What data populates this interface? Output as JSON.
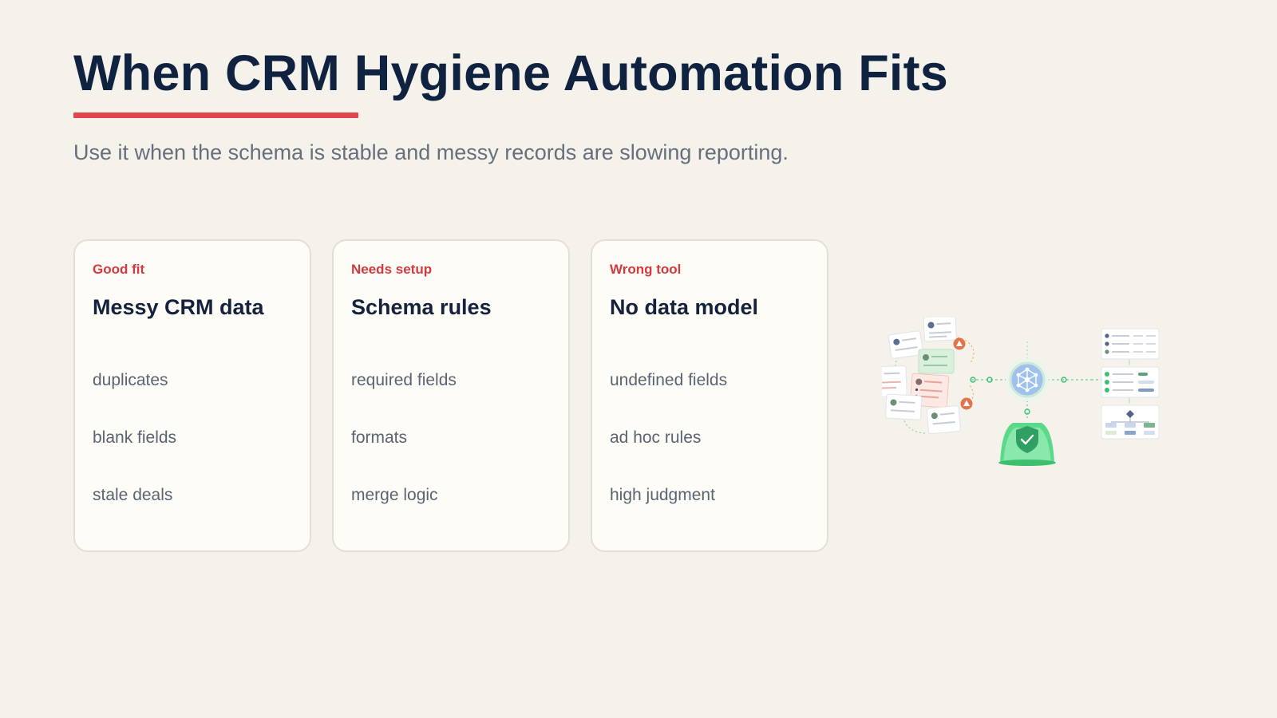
{
  "title": "When CRM Hygiene Automation Fits",
  "subtitle": "Use it when the schema is stable and messy records are slowing reporting.",
  "accent_color": "#e0464d",
  "cards": [
    {
      "tag": "Good fit",
      "title": "Messy CRM data",
      "items": [
        "duplicates",
        "blank fields",
        "stale deals"
      ]
    },
    {
      "tag": "Needs setup",
      "title": "Schema rules",
      "items": [
        "required fields",
        "formats",
        "merge logic"
      ]
    },
    {
      "tag": "Wrong tool",
      "title": "No data model",
      "items": [
        "undefined fields",
        "ad hoc rules",
        "high judgment"
      ]
    }
  ],
  "illustration": {
    "icons": [
      "contact-card-icon",
      "warning-icon",
      "network-hub-icon",
      "shield-check-icon",
      "checklist-icon",
      "flowchart-icon"
    ]
  }
}
